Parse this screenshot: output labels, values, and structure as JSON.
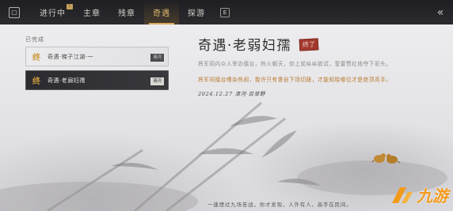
{
  "topbar": {
    "logo_icon": "map-icon",
    "tabs": [
      {
        "label": "进行中",
        "badge": "!",
        "active": false
      },
      {
        "label": "主章",
        "active": false
      },
      {
        "label": "残章",
        "active": false
      },
      {
        "label": "奇遇",
        "active": true
      },
      {
        "label": "探游",
        "active": false
      }
    ],
    "key_hint": "E",
    "back_icon": "double-chevron-left-icon"
  },
  "quest_list": {
    "section_label": "已完成",
    "items": [
      {
        "mark": "终",
        "label": "奇遇·梯子江湖·一",
        "tag": "清河",
        "selected": false
      },
      {
        "mark": "终",
        "label": "奇遇·老弱妇孺",
        "tag": "清河",
        "selected": true
      }
    ]
  },
  "detail": {
    "title": "奇遇·老弱妇孺",
    "seal": "终了",
    "para1": "将军祠内众人举办擂台，热火朝天，你上前纵纵欲试，誓要赞红线夺下彩头。",
    "para2": "将军祠擂台嘈杂热闹，我许只有妻自下场切磋，才能知晓哪位才是绝顶高手。",
    "date_line": "2024.12.27 清河·百草野"
  },
  "footer": {
    "text": "一連煙过九场苦战，你才发现，人外有人，高手在民间。"
  },
  "watermark": {
    "text": "九游",
    "icon": "nine-game-logo-icon",
    "color": "#f39a1c"
  },
  "colors": {
    "accent": "#d8a85a",
    "seal": "#a33a2e",
    "highlight_text": "#b87a2c"
  }
}
